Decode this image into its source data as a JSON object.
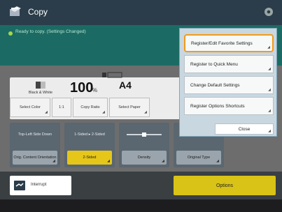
{
  "window": {
    "title": "Copy"
  },
  "status": {
    "message": "Ready to copy. (Settings Changed)"
  },
  "settings": {
    "color_mode": "Black & White",
    "copies": "100",
    "ratio_unit": "%",
    "paper_size": "A4"
  },
  "main_buttons": [
    {
      "label": "Select Color"
    },
    {
      "label": "1:1"
    },
    {
      "label": "Copy Ratio"
    },
    {
      "label": "Select Paper"
    }
  ],
  "tiles": [
    {
      "top": "Top-Left Side Down",
      "button": "Orig. Content Orientation"
    },
    {
      "top": "1-Sided ▸ 2-Sided",
      "button": "2-Sided"
    },
    {
      "top": "",
      "button": "Density"
    },
    {
      "top": "",
      "button": "Original Type"
    }
  ],
  "bottom": {
    "interrupt": "Interrupt",
    "options": "Options"
  },
  "menu": {
    "items": [
      {
        "label": "Register/Edit Favorite Settings"
      },
      {
        "label": "Register to Quick Menu"
      },
      {
        "label": "Change Default Settings"
      },
      {
        "label": "Register Options Shortcuts"
      }
    ],
    "close": "Close"
  },
  "colors": {
    "title_bar": "#2b3d4a",
    "status_bar": "#1b6b64",
    "highlight": "#f29a1b",
    "active_yellow": "#e6c619"
  }
}
